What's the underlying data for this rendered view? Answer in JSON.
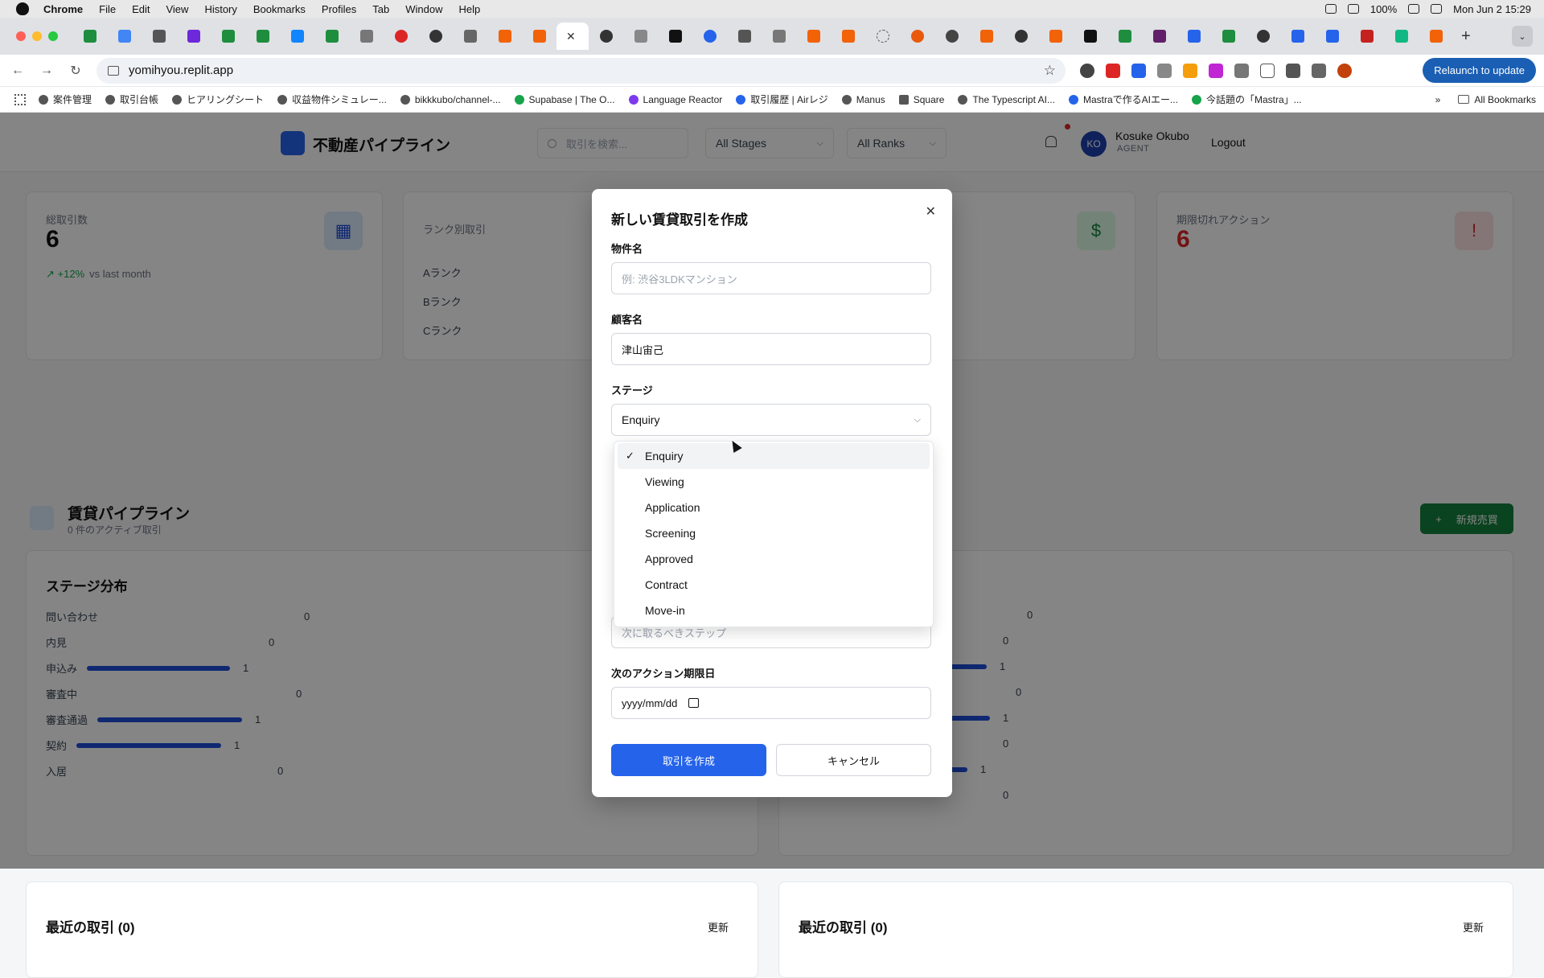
{
  "mac_menu": {
    "app": "Chrome",
    "items": [
      "File",
      "Edit",
      "View",
      "History",
      "Bookmarks",
      "Profiles",
      "Tab",
      "Window",
      "Help"
    ],
    "battery": "100%",
    "datetime": "Mon Jun 2  15:29"
  },
  "browser": {
    "url": "yomihyou.replit.app",
    "relaunch_label": "Relaunch to update",
    "bookmarks": [
      "案件管理",
      "取引台帳",
      "ヒアリングシート",
      "収益物件シミュレー...",
      "bikkkubo/channel-...",
      "Supabase | The O...",
      "Language Reactor",
      "取引履歴 | Airレジ",
      "Manus",
      "Square",
      "The Typescript AI...",
      "Mastraで作るAIエー...",
      "今話題の「Mastra」...",
      "All Bookmarks"
    ],
    "more_label": "»"
  },
  "header": {
    "title": "不動産パイプライン",
    "search_placeholder": "取引を検索...",
    "stage_filter": "All Stages",
    "rank_filter": "All Ranks",
    "user_initials": "KO",
    "user_name": "Kosuke Okubo",
    "user_role": "AGENT",
    "logout_label": "Logout"
  },
  "stats": {
    "total_label": "総取引数",
    "total_value": "6",
    "trend": "+12%",
    "trend_sub": "vs last month",
    "rank_label": "ランク別取引",
    "rank_a": "Aランク",
    "rank_b": "Bランク",
    "rank_c": "Cランク",
    "overdue_label": "期限切れアクション",
    "overdue_value": "6"
  },
  "pipeline": {
    "title": "賃貸パイプライン",
    "subtitle": "0 件のアクティブ取引",
    "new_button": "新規売買",
    "dist_title": "ステージ分布",
    "stages": [
      {
        "label": "問い合わせ",
        "count": "0",
        "fill": 0
      },
      {
        "label": "内見",
        "count": "0",
        "fill": 0
      },
      {
        "label": "申込み",
        "count": "1",
        "fill": 1
      },
      {
        "label": "審査中",
        "count": "0",
        "fill": 0
      },
      {
        "label": "審査通過",
        "count": "1",
        "fill": 1
      },
      {
        "label": "契約",
        "count": "1",
        "fill": 1
      },
      {
        "label": "入居",
        "count": "0",
        "fill": 0
      }
    ],
    "right_counts": [
      "0",
      "0",
      "1",
      "0",
      "1",
      "0",
      "1",
      "0"
    ]
  },
  "recent": {
    "left_title": "最近の取引 (0)",
    "left_refresh": "更新",
    "right_title": "最近の取引 (0)",
    "right_refresh": "更新"
  },
  "modal": {
    "title": "新しい賃貸取引を作成",
    "property_label": "物件名",
    "property_placeholder": "例: 渋谷3LDKマンション",
    "customer_label": "顧客名",
    "customer_value": "津山宙己",
    "stage_label": "ステージ",
    "stage_value": "Enquiry",
    "next_step_placeholder": "次に取るべきステップ",
    "due_label": "次のアクション期限日",
    "due_placeholder": "yyyy/mm/dd",
    "create_button": "取引を作成",
    "cancel_button": "キャンセル"
  },
  "dropdown": {
    "options": [
      "Enquiry",
      "Viewing",
      "Application",
      "Screening",
      "Approved",
      "Contract",
      "Move-in"
    ],
    "selected": "Enquiry"
  },
  "colors": {
    "primary": "#2563eb",
    "success": "#15803d",
    "danger": "#dc2626",
    "bar": "#1d4ed8"
  }
}
